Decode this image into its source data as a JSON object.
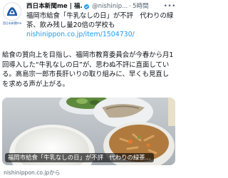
{
  "account": {
    "display_name": "西日本新聞me | 福...",
    "handle": "@nishinip...",
    "separator": "·",
    "time": "5時間",
    "avatar_caption": "西日本新聞me",
    "avatar_icon": "newspaper-logo-icon",
    "verified_color": "#1d9bf0"
  },
  "post": {
    "line1": "福岡市給食「牛乳なしの日」が不評　代わりの緑",
    "line2": "茶、飲み残し量20倍の学校も",
    "link": "nishinippon.co.jp/item/1504730/",
    "body": "給食の質向上を目指し、福岡市教育委員会が今春から月1回導入した“牛乳なしの日”が、思わぬ不評に直面している。高島宗一郎市長肝いりの取り組みに、早くも見直しを求める声が上がる。",
    "more_icon": "more-options-icon"
  },
  "card": {
    "caption": "福岡市給食「牛乳なしの日」が不評　代わりの緑茶...",
    "source": "nishinippon.co.jpから",
    "image_subject": "school-lunch-tray-photo"
  },
  "colors": {
    "link": "#1d9bf0",
    "text": "#0f1419",
    "muted": "#536471",
    "brand": "#1c5aa6"
  }
}
